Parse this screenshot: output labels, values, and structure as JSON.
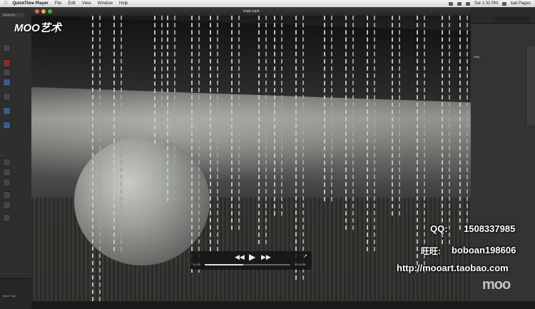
{
  "menubar": {
    "apple": "",
    "app_name": "QuickTime Player",
    "items": [
      "File",
      "Edit",
      "View",
      "Window",
      "Help"
    ],
    "clock": "Sat 1:32 PM",
    "right_app": "kait Pages"
  },
  "player": {
    "file_title": "chain.mp4",
    "time_elapsed": "00:04",
    "time_total": "00:00:08",
    "progress": 0.45
  },
  "left_panel": {
    "tab_label": "Dynamics",
    "bottom_label": "Move Tool"
  },
  "right_panel": {
    "item": "Help"
  },
  "overlay": {
    "watermark": "MOO艺术",
    "qq_label": "QQ:",
    "qq_value": "1508337985",
    "wangwang_label": "旺旺:",
    "wangwang_value": "boboan198606",
    "url": "http://mooart.taobao.com",
    "logo": "moo"
  },
  "icons": {
    "play": "play-icon",
    "rewind": "rewind-icon",
    "fastforward": "fast-forward-icon",
    "share": "share-icon"
  }
}
